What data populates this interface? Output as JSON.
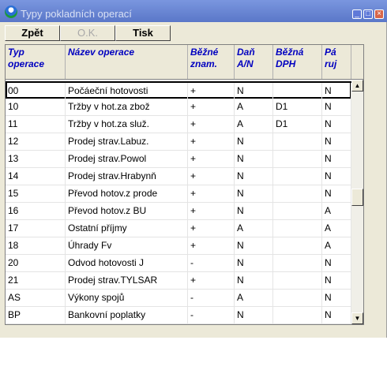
{
  "window": {
    "title": "Typy pokladních operací",
    "controls": {
      "minimize": "_",
      "maximize": "□",
      "close": "×"
    }
  },
  "toolbar": {
    "back_label": "Zpět",
    "ok_label": "O.K.",
    "print_label": "Tisk"
  },
  "table": {
    "headers": [
      {
        "line1": "Typ",
        "line2": "operace"
      },
      {
        "line1": "Název operace",
        "line2": ""
      },
      {
        "line1": "Běžné",
        "line2": "znam."
      },
      {
        "line1": "Daň",
        "line2": "A/N"
      },
      {
        "line1": "Běžná",
        "line2": "DPH"
      },
      {
        "line1": "Pá",
        "line2": "ruj"
      }
    ],
    "rows": [
      [
        "00",
        "Počáeční hotovosti",
        "+",
        "N",
        "",
        "N"
      ],
      [
        "10",
        "Tržby v hot.za zbož",
        "+",
        "A",
        "D1",
        "N"
      ],
      [
        "11",
        "Tržby v hot.za služ.",
        "+",
        "A",
        "D1",
        "N"
      ],
      [
        "12",
        "Prodej strav.Labuz.",
        "+",
        "N",
        "",
        "N"
      ],
      [
        "13",
        "Prodej strav.Powol",
        "+",
        "N",
        "",
        "N"
      ],
      [
        "14",
        "Prodej strav.Hrabynň",
        "+",
        "N",
        "",
        "N"
      ],
      [
        "15",
        "Převod hotov.z prode",
        "+",
        "N",
        "",
        "N"
      ],
      [
        "16",
        "Převod hotov.z BU",
        "+",
        "N",
        "",
        "A"
      ],
      [
        "17",
        "Ostatní příjmy",
        "+",
        "A",
        "",
        "A"
      ],
      [
        "18",
        "Úhrady Fv",
        "+",
        "N",
        "",
        "A"
      ],
      [
        "20",
        "Odvod hotovosti J",
        "-",
        "N",
        "",
        "N"
      ],
      [
        "21",
        "Prodej strav.TYLSAR",
        "+",
        "N",
        "",
        "N"
      ],
      [
        "AS",
        "Výkony spojů",
        "-",
        "A",
        "",
        "N"
      ],
      [
        "BP",
        "Bankovní poplatky",
        "-",
        "N",
        "",
        "N"
      ]
    ]
  },
  "scrollbar": {
    "up_arrow": "▲",
    "down_arrow": "▼"
  }
}
